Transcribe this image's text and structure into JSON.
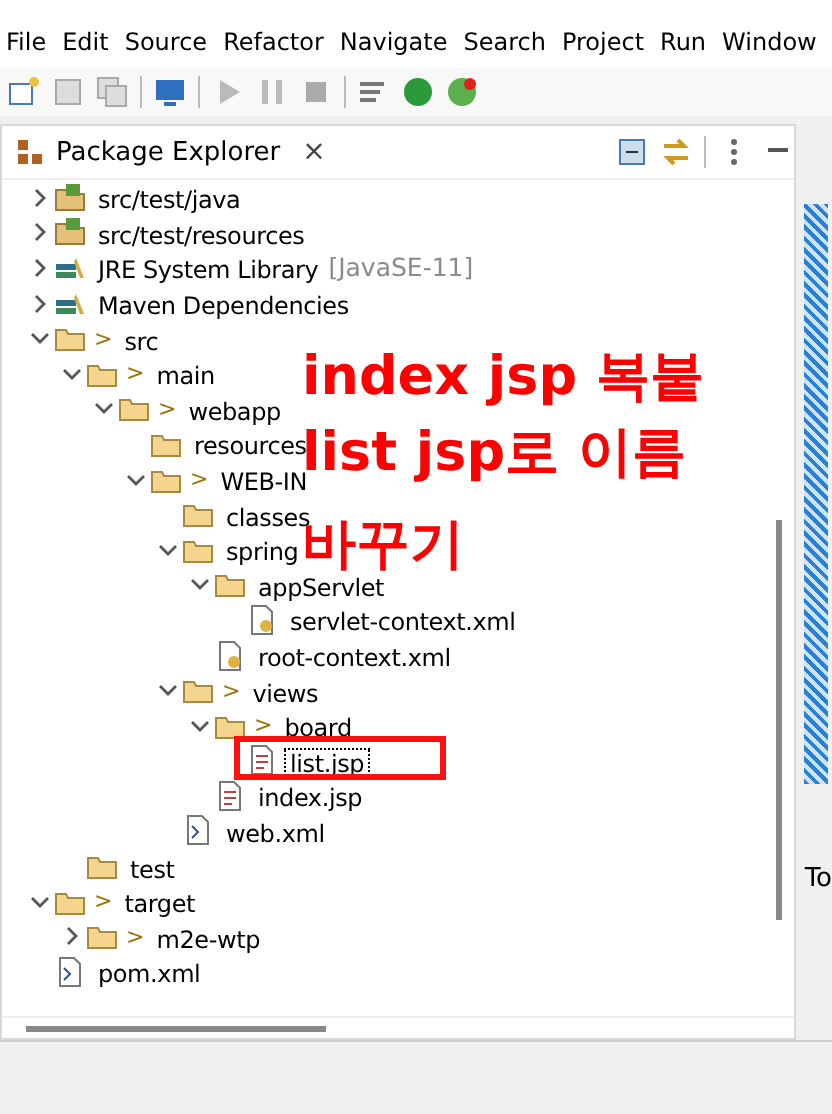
{
  "menu": [
    "File",
    "Edit",
    "Source",
    "Refactor",
    "Navigate",
    "Search",
    "Project",
    "Run",
    "Window"
  ],
  "panel": {
    "title": "Package Explorer",
    "close": "×"
  },
  "tree": [
    {
      "label": "src/test/java",
      "kind": "source-folder",
      "expanded": false
    },
    {
      "label": "src/test/resources",
      "kind": "source-folder",
      "expanded": false
    },
    {
      "label": "JRE System Library",
      "suffix": "[JavaSE-11]",
      "kind": "library",
      "expanded": false
    },
    {
      "label": "Maven Dependencies",
      "kind": "library",
      "expanded": false
    },
    {
      "label": "src",
      "decoration": ">",
      "kind": "folder",
      "expanded": true,
      "children": [
        {
          "label": "main",
          "decoration": ">",
          "kind": "folder",
          "expanded": true,
          "children": [
            {
              "label": "webapp",
              "decoration": ">",
              "kind": "folder",
              "expanded": true,
              "children": [
                {
                  "label": "resources",
                  "kind": "folder"
                },
                {
                  "label": "WEB-IN",
                  "decoration": ">",
                  "kind": "folder",
                  "expanded": true,
                  "children": [
                    {
                      "label": "classes",
                      "kind": "folder"
                    },
                    {
                      "label": "spring",
                      "kind": "folder",
                      "expanded": true,
                      "children": [
                        {
                          "label": "appServlet",
                          "kind": "folder",
                          "expanded": true,
                          "children": [
                            {
                              "label": "servlet-context.xml",
                              "kind": "spring-xml"
                            }
                          ]
                        },
                        {
                          "label": "root-context.xml",
                          "kind": "spring-xml"
                        }
                      ]
                    },
                    {
                      "label": "views",
                      "decoration": ">",
                      "kind": "folder",
                      "expanded": true,
                      "children": [
                        {
                          "label": "board",
                          "decoration": ">",
                          "kind": "folder",
                          "expanded": true,
                          "children": [
                            {
                              "label": "list.jsp",
                              "kind": "jsp",
                              "selected": true
                            }
                          ]
                        },
                        {
                          "label": "index.jsp",
                          "kind": "jsp",
                          "selected": false
                        }
                      ]
                    },
                    {
                      "label": "web.xml",
                      "kind": "xml"
                    }
                  ]
                }
              ]
            }
          ]
        },
        {
          "label": "test",
          "kind": "folder"
        }
      ]
    },
    {
      "label": "target",
      "decoration": ">",
      "kind": "folder",
      "expanded": true,
      "children": [
        {
          "label": "m2e-wtp",
          "decoration": ">",
          "kind": "folder",
          "expanded": false
        }
      ]
    },
    {
      "label": "pom.xml",
      "kind": "xml"
    }
  ],
  "annotation": [
    "index jsp 복붙",
    "list jsp로 이름",
    "바꾸기"
  ],
  "side_panel": {
    "tab": "To"
  }
}
